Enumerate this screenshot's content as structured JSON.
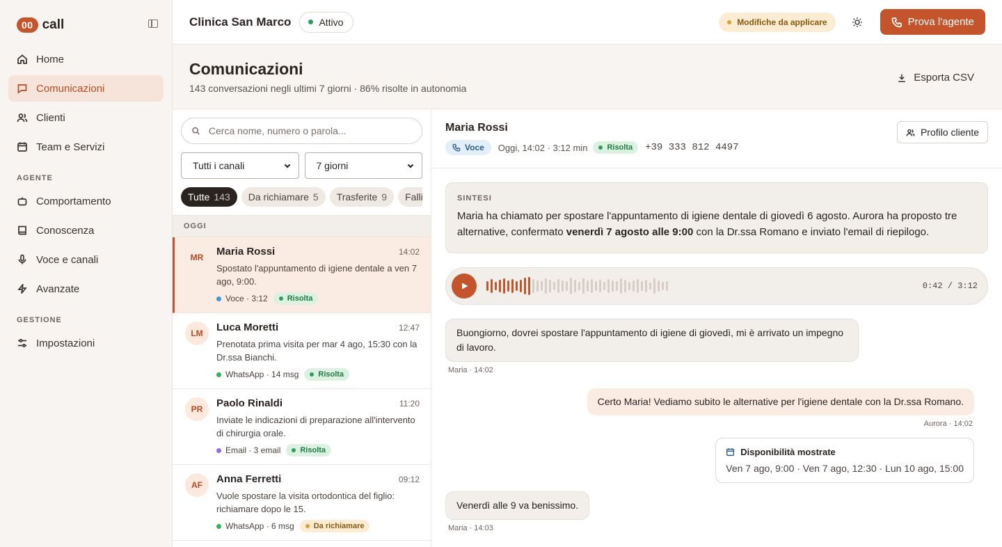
{
  "brand": {
    "badge": "00",
    "name": "call"
  },
  "sidebar": {
    "items": [
      {
        "label": "Home",
        "icon": "home-icon"
      },
      {
        "label": "Comunicazioni",
        "icon": "chat-icon",
        "active": true
      },
      {
        "label": "Clienti",
        "icon": "users-icon"
      },
      {
        "label": "Team e Servizi",
        "icon": "calendar-icon"
      }
    ],
    "section_agent": "AGENTE",
    "agent_items": [
      {
        "label": "Comportamento",
        "icon": "bot-icon"
      },
      {
        "label": "Conoscenza",
        "icon": "book-icon"
      },
      {
        "label": "Voce e canali",
        "icon": "mic-icon"
      },
      {
        "label": "Avanzate",
        "icon": "bolt-icon"
      }
    ],
    "section_manage": "GESTIONE",
    "manage_items": [
      {
        "label": "Impostazioni",
        "icon": "sliders-icon"
      }
    ]
  },
  "topbar": {
    "clinic": "Clinica San Marco",
    "status": "Attivo",
    "pending": "Modifiche da applicare",
    "cta": "Prova l'agente"
  },
  "page": {
    "title": "Comunicazioni",
    "subtitle": "143 conversazioni negli ultimi 7 giorni · 86% risolte in autonomia",
    "export": "Esporta CSV"
  },
  "list": {
    "search_placeholder": "Cerca nome, numero o parola...",
    "channel_filter": "Tutti i canali",
    "period_filter": "7 giorni",
    "chips": [
      {
        "label": "Tutte",
        "count": "143",
        "active": true
      },
      {
        "label": "Da richiamare",
        "count": "5"
      },
      {
        "label": "Trasferite",
        "count": "9"
      },
      {
        "label": "Fallite",
        "count": ""
      }
    ],
    "group": "OGGI",
    "conversations": [
      {
        "initials": "MR",
        "name": "Maria Rossi",
        "time": "14:02",
        "preview": "Spostato l'appuntamento di igiene dentale a ven 7 ago, 9:00.",
        "channel": "Voce · 3:12",
        "channel_color": "#3b9bd8",
        "status": "Risolta",
        "status_kind": "green",
        "active": true
      },
      {
        "initials": "LM",
        "name": "Luca Moretti",
        "time": "12:47",
        "preview": "Prenotata prima visita per mar 4 ago, 15:30 con la Dr.ssa Bianchi.",
        "channel": "WhatsApp · 14 msg",
        "channel_color": "#2fb35a",
        "status": "Risolta",
        "status_kind": "green"
      },
      {
        "initials": "PR",
        "name": "Paolo Rinaldi",
        "time": "11:20",
        "preview": "Inviate le indicazioni di preparazione all'intervento di chirurgia orale.",
        "channel": "Email · 3 email",
        "channel_color": "#8a6fe0",
        "status": "Risolta",
        "status_kind": "green"
      },
      {
        "initials": "AF",
        "name": "Anna Ferretti",
        "time": "09:12",
        "preview": "Vuole spostare la visita ortodontica del figlio: richiamare dopo le 15.",
        "channel": "WhatsApp · 6 msg",
        "channel_color": "#2fb35a",
        "status": "Da richiamare",
        "status_kind": "amber"
      }
    ]
  },
  "detail": {
    "name": "Maria Rossi",
    "channel": "Voce",
    "when": "Oggi, 14:02 · 3:12 min",
    "status": "Risolta",
    "phone": "+39 333 812 4497",
    "profile_button": "Profilo cliente",
    "summary_label": "SINTESI",
    "summary_before": "Maria ha chiamato per spostare l'appuntamento di igiene dentale di giovedì 6 agosto. Aurora ha proposto tre alternative, confermato ",
    "summary_bold": "venerdì 7 agosto alle 9:00",
    "summary_after": " con la Dr.ssa Romano e inviato l'email di riepilogo.",
    "player_time": "0:42 / 3:12",
    "player_progress": 0.22,
    "messages": [
      {
        "side": "in",
        "text": "Buongiorno, dovrei spostare l'appuntamento di igiene di giovedì, mi è arrivato un impegno di lavoro.",
        "caption": "Maria · 14:02"
      },
      {
        "side": "out",
        "text": "Certo Maria! Vediamo subito le alternative per l'igiene dentale con la Dr.ssa Romano.",
        "caption": "Aurora · 14:02"
      }
    ],
    "card": {
      "title": "Disponibilità mostrate",
      "body": "Ven 7 ago, 9:00 · Ven 7 ago, 12:30 · Lun 10 ago, 15:00"
    },
    "reply": {
      "text": "Venerdì alle 9 va benissimo.",
      "caption": "Maria · 14:03"
    }
  },
  "colors": {
    "accent": "#c4542c",
    "status_green": "#2f9e5a",
    "status_amber": "#d9a13a"
  }
}
